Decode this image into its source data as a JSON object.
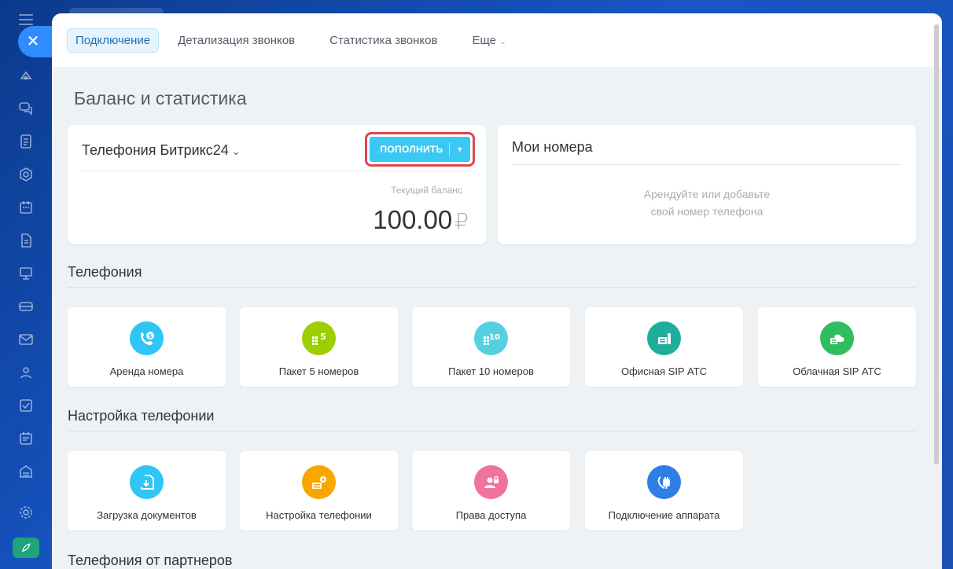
{
  "tabs": [
    {
      "label": "Подключение"
    },
    {
      "label": "Детализация звонков"
    },
    {
      "label": "Статистика звонков"
    },
    {
      "label": "Еще"
    }
  ],
  "page_title": "Баланс и статистика",
  "balance": {
    "title": "Телефония Битрикс24",
    "button": "ПОПОЛНИТЬ",
    "caption": "Текущий баланс",
    "amount": "100.00",
    "currency": "₽"
  },
  "numbers": {
    "title": "Мои номера",
    "line1": "Арендуйте или добавьте",
    "line2": "свой номер телефона"
  },
  "sections": {
    "telephony": "Телефония",
    "settings": "Настройка телефонии",
    "partners": "Телефония от партнеров"
  },
  "telephony_tiles": [
    {
      "label": "Аренда номера",
      "icon": "phone-rent-icon",
      "color": "#2fc6f6"
    },
    {
      "label": "Пакет 5 номеров",
      "icon": "package-5-icon",
      "color": "#9dcf00",
      "badge": "5"
    },
    {
      "label": "Пакет 10 номеров",
      "icon": "package-10-icon",
      "color": "#55d0e0",
      "badge": "10"
    },
    {
      "label": "Офисная SIP АТС",
      "icon": "office-pbx-icon",
      "color": "#1eae9b"
    },
    {
      "label": "Облачная SIP АТС",
      "icon": "cloud-pbx-icon",
      "color": "#2fbd5f"
    }
  ],
  "settings_tiles": [
    {
      "label": "Загрузка документов",
      "icon": "document-upload-icon",
      "color": "#2fc6f6"
    },
    {
      "label": "Настройка телефонии",
      "icon": "telephony-settings-icon",
      "color": "#f7a700"
    },
    {
      "label": "Права доступа",
      "icon": "access-rights-icon",
      "color": "#f0739c"
    },
    {
      "label": "Подключение аппарата",
      "icon": "device-connection-icon",
      "color": "#2f7ee6"
    }
  ]
}
